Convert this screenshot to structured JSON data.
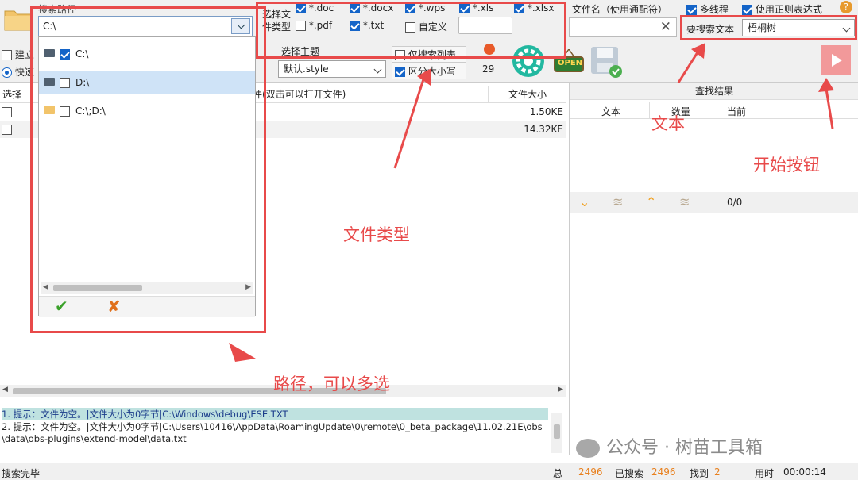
{
  "toolbar": {
    "search_path_label": "搜索路径",
    "search_path_value": "C:\\",
    "file_type_label_line1": "选择文",
    "file_type_label_line2": "件类型",
    "types": [
      {
        "label": "*.doc",
        "checked": true
      },
      {
        "label": "*.docx",
        "checked": true
      },
      {
        "label": "*.wps",
        "checked": true
      },
      {
        "label": "*.xls",
        "checked": true
      },
      {
        "label": "*.xlsx",
        "checked": true
      },
      {
        "label": "*.pdf",
        "checked": false
      },
      {
        "label": "*.txt",
        "checked": true
      },
      {
        "label": "自定义",
        "checked": false
      }
    ],
    "filename_label": "文件名（使用通配符）",
    "multithread_label": "多线程",
    "regex_label": "使用正则表达式",
    "search_text_label": "要搜索文本",
    "search_text_value": "梧桐树",
    "build_label": "建立",
    "quick_label": "快速",
    "theme_label": "选择主题",
    "theme_value": "默认.style",
    "only_search_list_label": "仅搜索列表",
    "case_sensitive_label": "区分大小写",
    "count_value": "29",
    "open_icon_text": "OPEN"
  },
  "dropdown": {
    "items": [
      {
        "label": "C:\\",
        "checked": true,
        "type": "drive"
      },
      {
        "label": "D:\\",
        "checked": false,
        "type": "drive"
      },
      {
        "label": "C:\\;D:\\",
        "checked": false,
        "type": "folder"
      }
    ]
  },
  "file_table": {
    "col_select": "选择",
    "col_name_partial": "件(双击可以打开文件)",
    "col_size": "文件大小",
    "rows": [
      {
        "size": "1.50KE"
      },
      {
        "size": "14.32KE"
      }
    ]
  },
  "results": {
    "title": "查找结果",
    "col_text": "文本",
    "col_count": "数量",
    "col_current": "当前",
    "nav_count": "0/0"
  },
  "log": {
    "lines": [
      "1. 提示：文件为空。|文件大小为0字节|C:\\Windows\\debug\\ESE.TXT",
      "2. 提示：文件为空。|文件大小为0字节|C:\\Users\\10416\\AppData\\RoamingUpdate\\0\\remote\\0_beta_package\\11.02.21E\\obs",
      "\\data\\obs-plugins\\extend-model\\data.txt"
    ]
  },
  "status": {
    "left": "搜索完毕",
    "total_label": "总",
    "total_value": "2496",
    "searched_label": "已搜索",
    "searched_value": "2496",
    "found_label": "找到",
    "found_value": "2",
    "time_label": "用时",
    "time_value": "00:00:14"
  },
  "annotations": {
    "text_label": "文本",
    "start_label": "开始按钮",
    "filetype_label": "文件类型",
    "path_label": "路径，可以多选"
  },
  "watermark": "公众号 · 树苗工具箱",
  "colors": {
    "annotation": "#e84a4a",
    "accent": "#1464c8"
  }
}
